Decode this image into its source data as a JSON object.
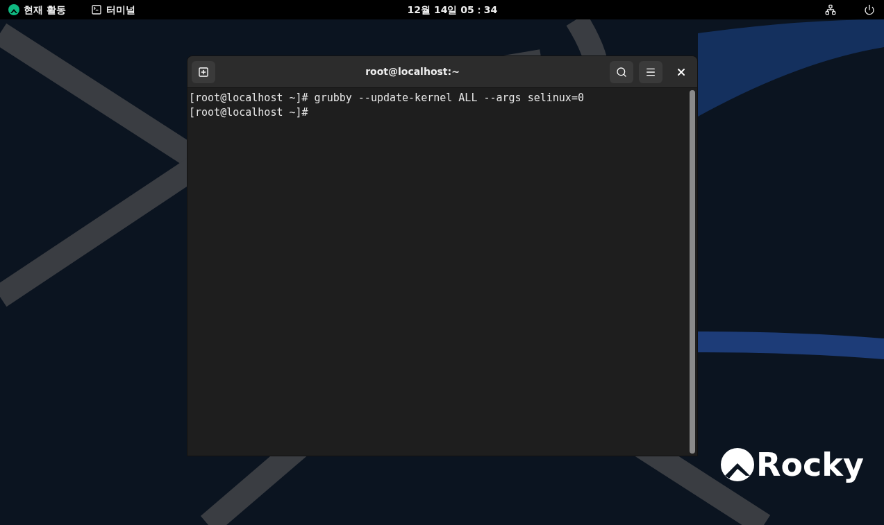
{
  "top_bar": {
    "activities": "현재 활동",
    "app": "터미널",
    "clock": "12월 14일 05：34"
  },
  "terminal": {
    "title": "root@localhost:~",
    "lines": [
      "[root@localhost ~]# grubby --update-kernel ALL --args selinux=0",
      "[root@localhost ~]#"
    ]
  },
  "logo": {
    "text": "Rocky"
  }
}
